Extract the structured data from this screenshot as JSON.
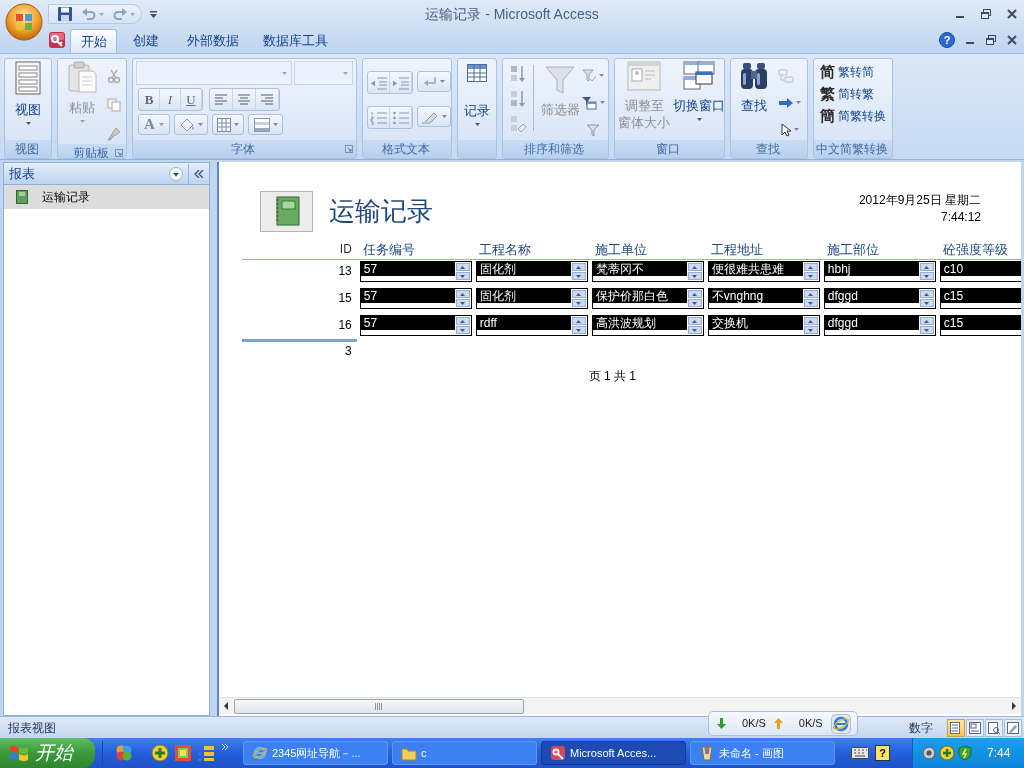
{
  "window": {
    "title": "运输记录 - Microsoft Access"
  },
  "ribbon": {
    "tabs": [
      {
        "label": "开始",
        "selected": true
      },
      {
        "label": "创建",
        "selected": false
      },
      {
        "label": "外部数据",
        "selected": false
      },
      {
        "label": "数据库工具",
        "selected": false
      }
    ],
    "help": "?",
    "groups": [
      {
        "kind": "view",
        "label": "视图",
        "button": {
          "label": "视图",
          "disabled": false
        }
      },
      {
        "kind": "clipboard",
        "label": "剪贴板",
        "button": {
          "label": "粘贴",
          "disabled": true
        }
      },
      {
        "kind": "font",
        "label": "字体",
        "style_buttons": [
          "B",
          "I",
          "U"
        ],
        "color_button": "A"
      },
      {
        "kind": "rich_text",
        "label": "格式文本"
      },
      {
        "kind": "records",
        "button": {
          "label": "记录",
          "disabled": false
        }
      },
      {
        "kind": "sort_filter",
        "label": "排序和筛选",
        "button": {
          "label": "筛选器",
          "disabled": true
        }
      },
      {
        "kind": "window",
        "label": "窗口",
        "buttons": [
          {
            "label_lines": [
              "调整至",
              "窗体大小"
            ],
            "disabled": true
          },
          {
            "label_lines": [
              "切换窗口"
            ],
            "disabled": false
          }
        ]
      },
      {
        "kind": "find",
        "label": "查找",
        "button": {
          "label": "查找",
          "disabled": false
        }
      },
      {
        "kind": "chinese_convert",
        "label": "中文简繁转换",
        "items": [
          {
            "glyph": "简",
            "label": "繁转简"
          },
          {
            "glyph": "繁",
            "label": "简转繁"
          },
          {
            "glyph": "簡",
            "label": "简繁转换"
          }
        ]
      }
    ]
  },
  "navigation_pane": {
    "title": "报表",
    "items": [
      {
        "label": "运输记录",
        "selected": true
      }
    ]
  },
  "report": {
    "title": "运输记录",
    "date": "2012年9月25日 星期二",
    "time": "7:44:12",
    "columns": [
      "ID",
      "任务编号",
      "工程名称",
      "施工单位",
      "工程地址",
      "施工部位",
      "砼强度等级"
    ],
    "rows": [
      {
        "cells": [
          "13",
          "57",
          "固化剂",
          "梵蒂冈不",
          "便很难共患难",
          "hbhj",
          "c10"
        ]
      },
      {
        "cells": [
          "15",
          "57",
          "固化剂",
          "保护价那白色",
          "不vnghng",
          "dfggd",
          "c15"
        ]
      },
      {
        "cells": [
          "16",
          "57",
          "rdff",
          "高洪波规划",
          "交换机",
          "dfggd",
          "c15"
        ]
      }
    ],
    "record_count": "3",
    "page_footer": "页 1 共 1"
  },
  "status_bar": {
    "text": "报表视图",
    "network": {
      "download": "0K/S",
      "upload": "0K/S"
    },
    "mode": "数字",
    "views": [
      {
        "kind": "report",
        "selected": true
      },
      {
        "kind": "layout",
        "selected": false
      },
      {
        "kind": "print_preview",
        "selected": false
      },
      {
        "kind": "design",
        "selected": false
      }
    ]
  },
  "taskbar": {
    "start": "开始",
    "tasks": [
      {
        "kind": "browser",
        "label": "2345网址导航－...",
        "selected": false
      },
      {
        "kind": "folder",
        "label": "c",
        "selected": false
      },
      {
        "kind": "access",
        "label": "Microsoft Acces...",
        "selected": true
      },
      {
        "kind": "paint",
        "label": "未命名 - 画图",
        "selected": false
      }
    ],
    "language_help": "?",
    "clock": "7:44"
  }
}
